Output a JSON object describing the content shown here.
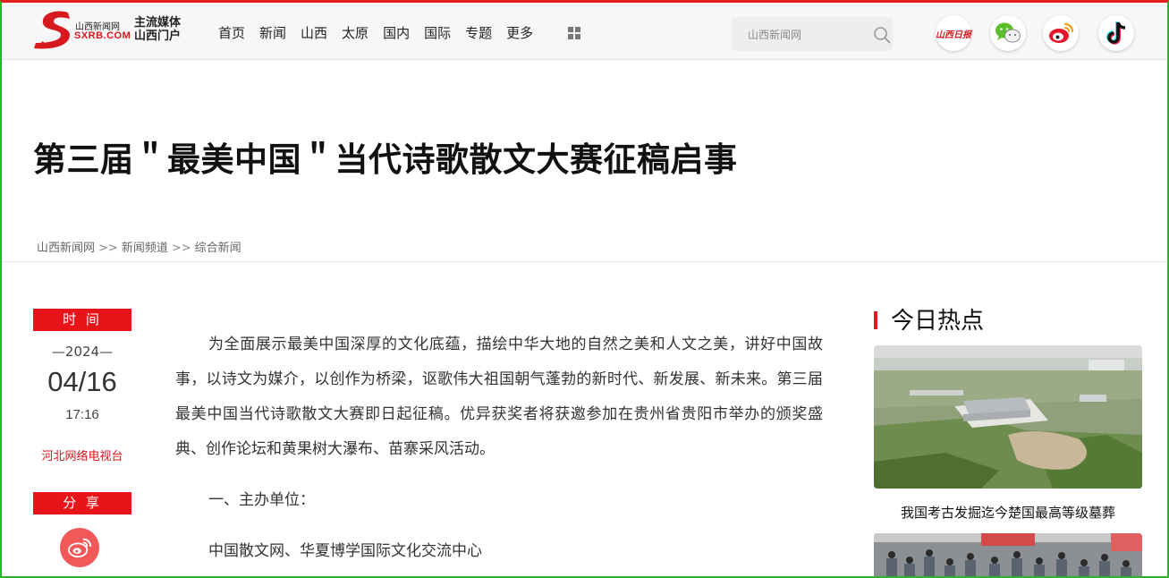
{
  "header": {
    "logo_cn": "山西新闻网",
    "logo_en": "SXRB.COM",
    "slogan_line1": "主流媒体",
    "slogan_line2": "山西门户",
    "nav": [
      "首页",
      "新闻",
      "山西",
      "太原",
      "国内",
      "国际",
      "专题",
      "更多"
    ],
    "search_placeholder": "山西新闻网",
    "sx_daily_label": "山西日报",
    "social_icons": [
      "shanxi-daily-icon",
      "wechat-icon",
      "weibo-icon",
      "tiktok-icon"
    ]
  },
  "article": {
    "title": "第三届＂最美中国＂当代诗歌散文大赛征稿启事",
    "breadcrumb": [
      "山西新闻网",
      "新闻频道",
      "综合新闻"
    ],
    "breadcrumb_sep": ">>",
    "time_label": "时 间",
    "year": "—2024—",
    "date": "04/16",
    "time": "17:16",
    "source": "河北网络电视台",
    "share_label": "分 享",
    "paragraphs": [
      "为全面展示最美中国深厚的文化底蕴，描绘中华大地的自然之美和人文之美，讲好中国故事，以诗文为媒介，以创作为桥梁，讴歌伟大祖国朝气蓬勃的新时代、新发展、新未来。第三届最美中国当代诗歌散文大赛即日起征稿。优异获奖者将获邀参加在贵州省贵阳市举办的颁奖盛典、创作论坛和黄果树大瀑布、苗寨采风活动。",
      "一、主办单位：",
      "中国散文网、华夏博学国际文化交流中心"
    ]
  },
  "sidebar": {
    "hot_title": "今日热点",
    "items": [
      {
        "caption": "我国考古发掘迄今楚国最高等级墓葬"
      }
    ]
  },
  "colors": {
    "accent_red": "#e8141a",
    "frame_green": "#2bb52b",
    "source_red": "#d7181f"
  }
}
